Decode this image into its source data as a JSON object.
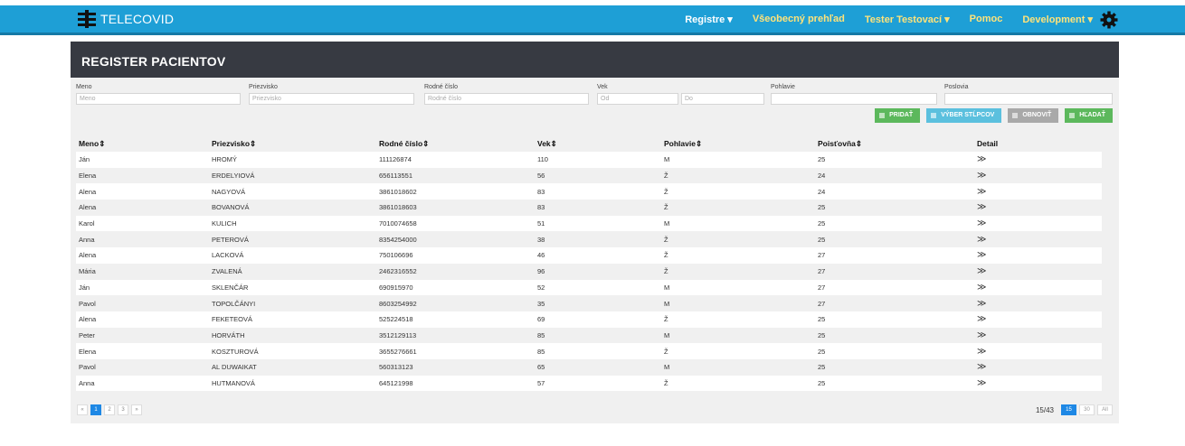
{
  "app": {
    "brand": "TELECOVID"
  },
  "nav": {
    "items": [
      "Registre ▾",
      "Všeobecný prehľad",
      "Tester Testovací ▾",
      "Pomoc",
      "Development ▾"
    ]
  },
  "panel": {
    "title": "REGISTER PACIENTOV"
  },
  "filters": {
    "meno": {
      "label": "Meno",
      "placeholder": "Meno"
    },
    "priezvisko": {
      "label": "Priezvisko",
      "placeholder": "Priezvisko"
    },
    "rodne_cislo": {
      "label": "Rodné číslo",
      "placeholder": "Rodné číslo"
    },
    "vek": {
      "label": "Vek",
      "from": "Od",
      "to": "Do"
    },
    "pohlavie": {
      "label": "Pohlavie",
      "placeholder": ""
    },
    "postovia": {
      "label": "Poslovia",
      "placeholder": ""
    }
  },
  "actions": {
    "add": "PRIDAŤ",
    "columns": "VÝBER STĹPCOV",
    "refresh": "OBNOVIŤ",
    "search": "HĽADAŤ"
  },
  "table": {
    "headers": [
      "Meno⇕",
      "Priezvisko⇕",
      "Rodné číslo⇕",
      "Vek⇕",
      "Pohlavie⇕",
      "Poisťovňa⇕",
      "Detail"
    ],
    "rows": [
      [
        "Ján",
        "HROMÝ",
        "111126874",
        "110",
        "M",
        "25",
        "≫"
      ],
      [
        "Elena",
        "ERDELYIOVÁ",
        "656113551",
        "56",
        "Ž",
        "24",
        "≫"
      ],
      [
        "Alena",
        "NAGYOVÁ",
        "3861018602",
        "83",
        "Ž",
        "24",
        "≫"
      ],
      [
        "Alena",
        "BOVANOVÁ",
        "3861018603",
        "83",
        "Ž",
        "25",
        "≫"
      ],
      [
        "Karol",
        "KULICH",
        "7010074658",
        "51",
        "M",
        "25",
        "≫"
      ],
      [
        "Anna",
        "PETEROVÁ",
        "8354254000",
        "38",
        "Ž",
        "25",
        "≫"
      ],
      [
        "Alena",
        "LACKOVÁ",
        "750106696",
        "46",
        "Ž",
        "27",
        "≫"
      ],
      [
        "Mária",
        "ZVALENÁ",
        "2462316552",
        "96",
        "Ž",
        "27",
        "≫"
      ],
      [
        "Ján",
        "SKLENČÁR",
        "690915970",
        "52",
        "M",
        "27",
        "≫"
      ],
      [
        "Pavol",
        "TOPOLČÁNYI",
        "8603254992",
        "35",
        "M",
        "27",
        "≫"
      ],
      [
        "Alena",
        "FEKETEOVÁ",
        "525224518",
        "69",
        "Ž",
        "25",
        "≫"
      ],
      [
        "Peter",
        "HORVÁTH",
        "3512129113",
        "85",
        "M",
        "25",
        "≫"
      ],
      [
        "Elena",
        "KOSZTUROVÁ",
        "3655276661",
        "85",
        "Ž",
        "25",
        "≫"
      ],
      [
        "Pavol",
        "AL DUWAIKAT",
        "560313123",
        "65",
        "M",
        "25",
        "≫"
      ],
      [
        "Anna",
        "HUTMANOVÁ",
        "645121998",
        "57",
        "Ž",
        "25",
        "≫"
      ]
    ]
  },
  "pagination": {
    "pages": [
      "«",
      "1",
      "2",
      "3",
      "»"
    ],
    "active_page": "1",
    "count": "15/43",
    "sizes": [
      "15",
      "30",
      "All"
    ],
    "active_size": "15"
  },
  "colors": {
    "nav": "#1e9fd6",
    "panel_head": "#373a42",
    "green": "#5cb85c",
    "blue": "#5bc0de",
    "active": "#1e88e5"
  }
}
